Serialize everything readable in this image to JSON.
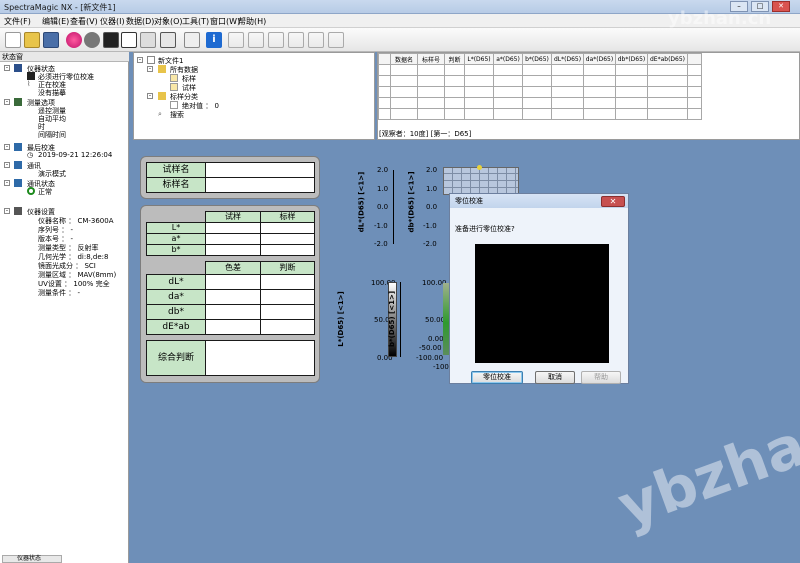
{
  "window": {
    "title": "SpectraMagic NX - [新文件1]"
  },
  "menu": [
    "文件(F)",
    "编辑(E)",
    "查看(V)",
    "仪器(I)",
    "数据(D)",
    "对象(O)",
    "工具(T)",
    "窗口(W)",
    "帮助(H)"
  ],
  "status_pane": {
    "header": "状态窗",
    "instrument_status": {
      "label": "仪器状态",
      "items": [
        "必须进行零位校准",
        "正在校准",
        "没有描摹"
      ]
    },
    "measure_options": {
      "label": "测量选项",
      "items": [
        "遥控测量",
        "自动平均",
        "时",
        "间隔时间"
      ]
    },
    "last_calibration": {
      "label": "最后校准",
      "value": "2019-09-21 12:26:04"
    },
    "comm": {
      "label": "通讯",
      "value": "演示模式"
    },
    "comm_status": {
      "label": "通讯状态",
      "value": "正常"
    },
    "instrument_settings": {
      "label": "仪器设置",
      "items": [
        "仪器名称 ： CM-3600A",
        "序列号 ： -",
        "版本号 ： -",
        "测量类型 ： 反射率",
        "几何光学 ： di:8,de:8",
        "镜面光成分 ： SCI",
        "测量区域 ： MAV(8mm)",
        "UV设置 ： 100% 完全",
        "测量条件 ： -"
      ]
    },
    "bottom_tab": "仪器状态"
  },
  "tree": {
    "root": "新文件1",
    "all_data": "所有数据",
    "standard": "标样",
    "sample": "试样",
    "std_class": "标样分类",
    "absolute": "绝对值 ： 0",
    "search": "搜索"
  },
  "table": {
    "headers": [
      "数据名",
      "标样号",
      "判断",
      "L*(D65)",
      "a*(D65)",
      "b*(D65)",
      "dL*(D65)",
      "da*(D65)",
      "db*(D65)",
      "dE*ab(D65)"
    ],
    "footer": "[观察者：10度] [第一：D65]"
  },
  "form": {
    "sample_name": "试样名",
    "standard_name": "标样名",
    "col_sample": "试样",
    "col_standard": "标样",
    "rows_abs": [
      "L*",
      "a*",
      "b*"
    ],
    "col_diff": "色差",
    "col_judge": "判断",
    "rows_diff": [
      "dL*",
      "da*",
      "db*",
      "dE*ab"
    ],
    "overall": "综合判断"
  },
  "charts": {
    "scale1_ticks": [
      "2.0",
      "1.0",
      "0.0",
      "-1.0",
      "-2.0"
    ],
    "scale1_label": "dL*(D65) [<1>]",
    "scale2_ticks": [
      "2.0",
      "1.0",
      "0.0",
      "-1.0",
      "-2.0"
    ],
    "scale2_label": "db*(D65) [<1>]",
    "scale3_ticks": [
      "100.00",
      "50.00",
      "0.00"
    ],
    "scale3_label": "L*(D65) [<1>]",
    "scale4_ticks": [
      "100.00",
      "50.00",
      "0.00",
      "-50.00",
      "-100.00",
      "-100"
    ],
    "scale4_label": "b*(D65) [<1>]"
  },
  "dialog": {
    "title": "零位校准",
    "close": "✕",
    "message": "准备进行零位校准?",
    "ok": "零位校准",
    "cancel": "取消",
    "help": "帮助"
  },
  "watermark": "ybzhan.cn"
}
